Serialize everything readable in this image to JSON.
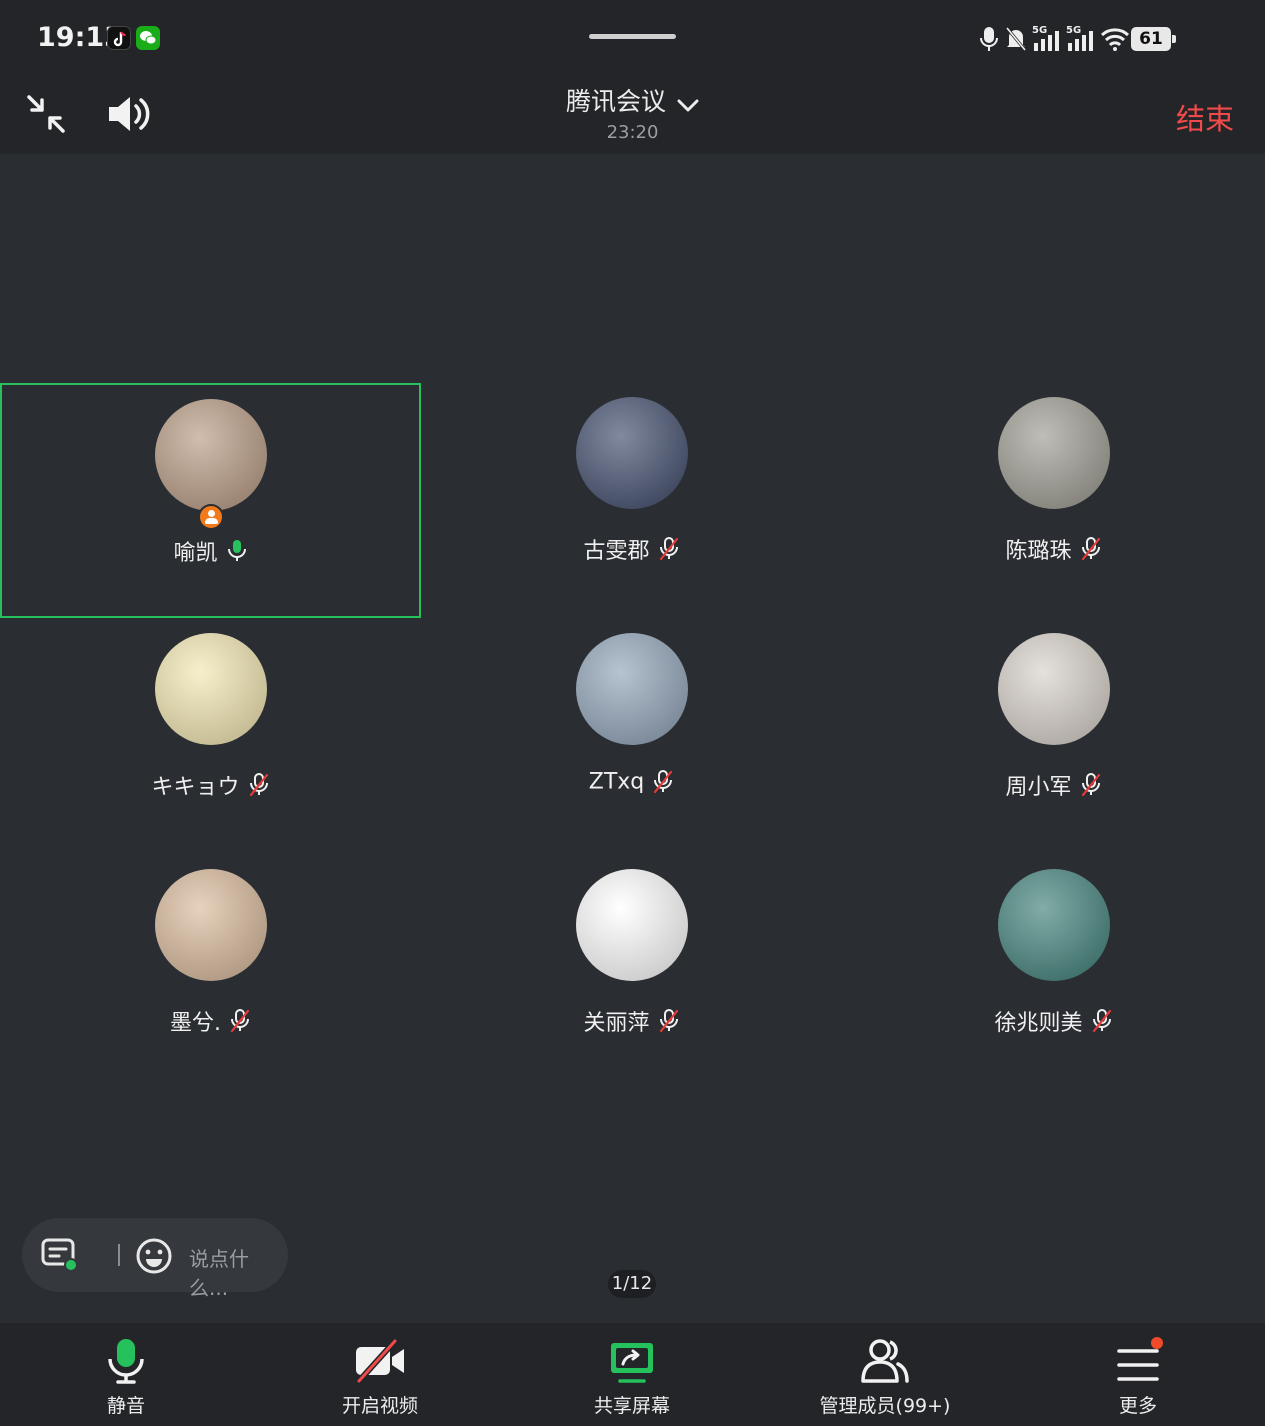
{
  "status_bar": {
    "time": "19:13",
    "apps": [
      "tiktok-icon",
      "wechat-icon"
    ],
    "icons": [
      "mic-icon",
      "bell-off-icon",
      "signal-5g-icon",
      "signal-5g-icon",
      "wifi-icon"
    ],
    "network_labels": [
      "5G",
      "5G"
    ],
    "battery": "61"
  },
  "header": {
    "title": "腾讯会议",
    "timer": "23:20",
    "end_label": "结束"
  },
  "participants": [
    {
      "name": "喻凯",
      "mic": "on",
      "host": true,
      "active": true,
      "avatar_color": "#b89a82"
    },
    {
      "name": "古雯郡",
      "mic": "off",
      "host": false,
      "active": false,
      "avatar_color": "#3d4a6a"
    },
    {
      "name": "陈璐珠",
      "mic": "off",
      "host": false,
      "active": false,
      "avatar_color": "#9c9a90"
    },
    {
      "name": "キキョウ",
      "mic": "off",
      "host": false,
      "active": false,
      "avatar_color": "#f3e7b0"
    },
    {
      "name": "ZTxq",
      "mic": "off",
      "host": false,
      "active": false,
      "avatar_color": "#8fa3b8"
    },
    {
      "name": "周小军",
      "mic": "off",
      "host": false,
      "active": false,
      "avatar_color": "#d7d0c8"
    },
    {
      "name": "墨兮.",
      "mic": "off",
      "host": false,
      "active": false,
      "avatar_color": "#d9b99a"
    },
    {
      "name": "关丽萍",
      "mic": "off",
      "host": false,
      "active": false,
      "avatar_color": "#ffffff"
    },
    {
      "name": "徐兆则美",
      "mic": "off",
      "host": false,
      "active": false,
      "avatar_color": "#3e8079"
    }
  ],
  "chat": {
    "placeholder": "说点什么..."
  },
  "pager": "1/12",
  "toolbar": {
    "mute_label": "静音",
    "video_label": "开启视频",
    "share_label": "共享屏幕",
    "members_label": "管理成员(99+)",
    "more_label": "更多"
  },
  "colors": {
    "background": "#2a2d31",
    "bar": "#232528",
    "accent_green": "#25c15c",
    "end_red": "#f04a4a",
    "host_orange": "#f27a1b"
  }
}
